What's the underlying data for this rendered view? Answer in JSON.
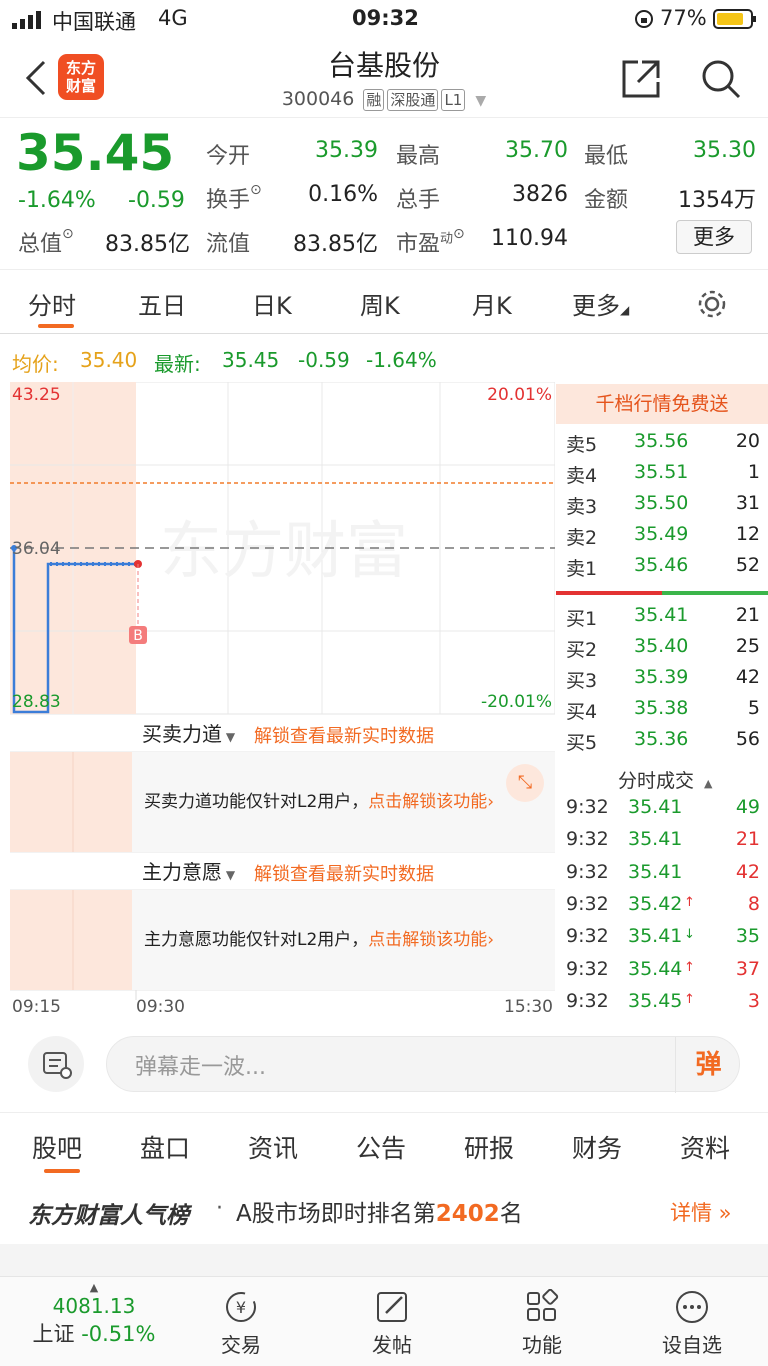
{
  "status": {
    "carrier": "中国联通",
    "network": "4G",
    "time": "09:32",
    "battery": "77%"
  },
  "nav": {
    "logo": "东方\n财富",
    "title": "台基股份",
    "code": "300046",
    "tags": [
      "融",
      "深股通",
      "L1"
    ]
  },
  "quote": {
    "price": "35.45",
    "change_pct": "-1.64%",
    "change": "-0.59",
    "fields": [
      {
        "label": "今开",
        "value": "35.39"
      },
      {
        "label": "最高",
        "value": "35.70"
      },
      {
        "label": "最低",
        "value": "35.30"
      },
      {
        "label": "换手",
        "value": "0.16%"
      },
      {
        "label": "总手",
        "value": "3826"
      },
      {
        "label": "金额",
        "value": "1354万"
      },
      {
        "label": "总值",
        "value": "83.85亿"
      },
      {
        "label": "流值",
        "value": "83.85亿"
      },
      {
        "label": "市盈",
        "sup": "动",
        "value": "110.94"
      }
    ],
    "more_button": "更多"
  },
  "chart_tabs": [
    "分时",
    "五日",
    "日K",
    "周K",
    "月K",
    "更多"
  ],
  "pricebar": {
    "avg_label": "均价:",
    "avg_value": "35.40",
    "latest_label": "最新:",
    "latest_value": "35.45",
    "change": "-0.59",
    "change_pct": "-1.64%"
  },
  "chart": {
    "y_top": "43.25",
    "y_mid": "36.04",
    "y_bottom": "28.83",
    "pct_top": "20.01%",
    "pct_bottom": "-20.01%",
    "watermark": "东方财富",
    "x_labels": [
      "09:15",
      "09:30",
      "15:30"
    ],
    "b_marker": "B"
  },
  "chart_data": {
    "type": "line",
    "series": [
      {
        "values": [
          35.45,
          35.45
        ]
      }
    ],
    "ylim": [
      28.83,
      43.25
    ],
    "reference": 36.04
  },
  "panels": {
    "p1_title": "买卖力道",
    "p1_link": "解锁查看最新实时数据",
    "p1_text": "买卖力道功能仅针对L2用户，",
    "p1_action": "点击解锁该功能",
    "p2_title": "主力意愿",
    "p2_link": "解锁查看最新实时数据",
    "p2_text": "主力意愿功能仅针对L2用户，",
    "p2_action": "点击解锁该功能"
  },
  "orderbook": {
    "promo": "千档行情免费送",
    "sells": [
      {
        "label": "卖5",
        "price": "35.56",
        "vol": "20"
      },
      {
        "label": "卖4",
        "price": "35.51",
        "vol": "1"
      },
      {
        "label": "卖3",
        "price": "35.50",
        "vol": "31"
      },
      {
        "label": "卖2",
        "price": "35.49",
        "vol": "12"
      },
      {
        "label": "卖1",
        "price": "35.46",
        "vol": "52"
      }
    ],
    "buys": [
      {
        "label": "买1",
        "price": "35.41",
        "vol": "21"
      },
      {
        "label": "买2",
        "price": "35.40",
        "vol": "25"
      },
      {
        "label": "买3",
        "price": "35.39",
        "vol": "42"
      },
      {
        "label": "买4",
        "price": "35.38",
        "vol": "5"
      },
      {
        "label": "买5",
        "price": "35.36",
        "vol": "56"
      }
    ],
    "trades_title": "分时成交",
    "trades": [
      {
        "time": "9:32",
        "price": "35.41",
        "arrow": "",
        "vol": "49"
      },
      {
        "time": "9:32",
        "price": "35.41",
        "arrow": "",
        "vol": "21"
      },
      {
        "time": "9:32",
        "price": "35.41",
        "arrow": "",
        "vol": "42"
      },
      {
        "time": "9:32",
        "price": "35.42",
        "arrow": "↑",
        "vol": "8"
      },
      {
        "time": "9:32",
        "price": "35.41",
        "arrow": "↓",
        "vol": "35"
      },
      {
        "time": "9:32",
        "price": "35.44",
        "arrow": "↑",
        "vol": "37"
      },
      {
        "time": "9:32",
        "price": "35.45",
        "arrow": "↑",
        "vol": "3"
      }
    ]
  },
  "danmu": {
    "placeholder": "弹幕走一波...",
    "send": "弹"
  },
  "info_tabs": [
    "股吧",
    "盘口",
    "资讯",
    "公告",
    "研报",
    "财务",
    "资料"
  ],
  "rank": {
    "brand": "东方财富人气榜",
    "dot": "·",
    "text_pre": "A股市场即时排名第",
    "rank": "2402",
    "text_post": "名",
    "detail": "详情"
  },
  "bottom_nav": {
    "index_value": "4081.13",
    "index_name": "上证",
    "index_change": "-0.51%",
    "items": [
      "交易",
      "发帖",
      "功能",
      "设自选"
    ]
  }
}
